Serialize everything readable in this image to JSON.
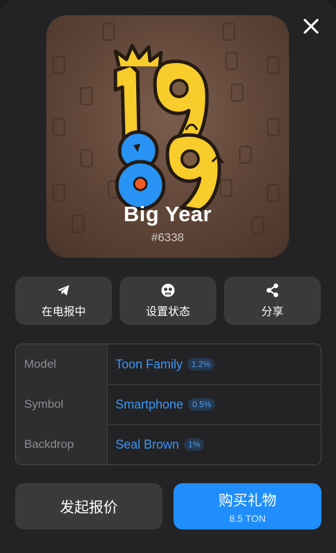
{
  "gift": {
    "title": "Big Year",
    "number": "#6338",
    "artwork": "1989-big-year-artwork",
    "backdrop_color": "#5f4537"
  },
  "actions": [
    {
      "label": "在电报中",
      "icon": "telegram-send-icon"
    },
    {
      "label": "设置状态",
      "icon": "status-icon"
    },
    {
      "label": "分享",
      "icon": "share-icon"
    }
  ],
  "attributes": [
    {
      "key": "Model",
      "value": "Toon Family",
      "rarity": "1.2%"
    },
    {
      "key": "Symbol",
      "value": "Smartphone",
      "rarity": "0.5%"
    },
    {
      "key": "Backdrop",
      "value": "Seal Brown",
      "rarity": "1%"
    }
  ],
  "buttons": {
    "offer_label": "发起报价",
    "buy_label": "购买礼物",
    "buy_price": "8.5 TON"
  },
  "colors": {
    "accent": "#1f8efa",
    "link": "#3e95f0",
    "surface": "#3a3a3c",
    "background": "#232325"
  }
}
